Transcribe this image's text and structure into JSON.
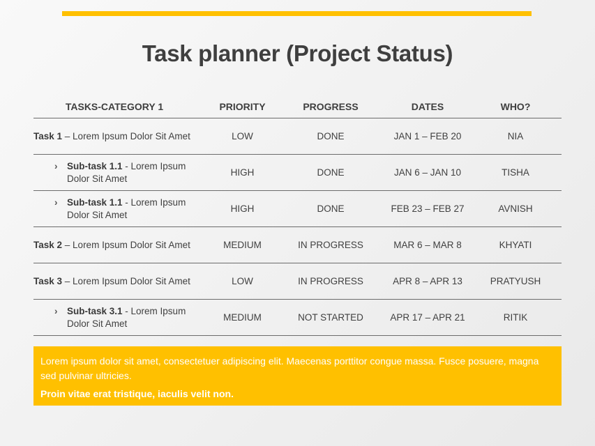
{
  "accent_color": "#ffc000",
  "title": "Task planner (Project Status)",
  "table": {
    "headers": [
      "TASKS-CATEGORY 1",
      "PRIORITY",
      "PROGRESS",
      "DATES",
      "WHO?"
    ],
    "rows": [
      {
        "is_sub": false,
        "name": "Task 1",
        "separator": " – ",
        "desc": "Lorem Ipsum Dolor Sit Amet",
        "priority": "LOW",
        "progress": "DONE",
        "dates": "JAN 1 – FEB 20",
        "who": "NIA"
      },
      {
        "is_sub": true,
        "name": "Sub-task  1.1",
        "separator": " - ",
        "desc": "Lorem Ipsum Dolor Sit Amet",
        "priority": "HIGH",
        "progress": "DONE",
        "dates": "JAN 6 – JAN 10",
        "who": "TISHA"
      },
      {
        "is_sub": true,
        "name": "Sub-task  1.1",
        "separator": " - ",
        "desc": "Lorem Ipsum Dolor Sit Amet",
        "priority": "HIGH",
        "progress": "DONE",
        "dates": "FEB 23 – FEB 27",
        "who": "AVNISH"
      },
      {
        "is_sub": false,
        "name": "Task 2",
        "separator": " – ",
        "desc": "Lorem Ipsum Dolor Sit Amet",
        "priority": "MEDIUM",
        "progress": "IN PROGRESS",
        "dates": "MAR 6 – MAR 8",
        "who": "KHYATI"
      },
      {
        "is_sub": false,
        "name": "Task 3",
        "separator": " – ",
        "desc": "Lorem Ipsum Dolor Sit Amet",
        "priority": "LOW",
        "progress": "IN PROGRESS",
        "dates": "APR 8 – APR 13",
        "who": "PRATYUSH"
      },
      {
        "is_sub": true,
        "name": "Sub-task  3.1",
        "separator": " - ",
        "desc": "Lorem Ipsum Dolor Sit Amet",
        "priority": "MEDIUM",
        "progress": "NOT STARTED",
        "dates": "APR 17 – APR 21",
        "who": "RITIK"
      }
    ],
    "sub_bullet_icon": "chevron-right-icon",
    "sub_bullet_glyph": "›"
  },
  "note": {
    "text": "Lorem ipsum dolor sit amet, consectetuer adipiscing elit.  Maecenas porttitor congue massa. Fusce posuere, magna sed pulvinar ultricies.",
    "bold_text": "Proin vitae erat tristique, iaculis velit non."
  }
}
